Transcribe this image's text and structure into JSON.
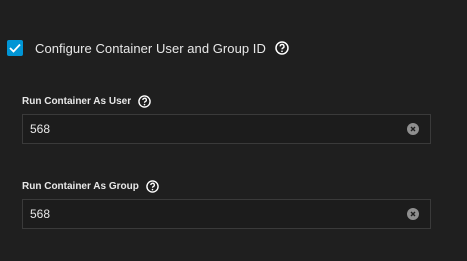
{
  "options": {
    "configure_user_group": {
      "label": "Configure Container User and Group ID",
      "checked": true,
      "icon": "checkmark-icon",
      "help_icon": "help-circle-icon"
    }
  },
  "fields": {
    "run_as_user": {
      "label": "Run Container As User",
      "value": "568",
      "clear_icon": "clear-icon",
      "help_icon": "help-circle-icon"
    },
    "run_as_group": {
      "label": "Run Container As Group",
      "value": "568",
      "clear_icon": "clear-icon",
      "help_icon": "help-circle-icon"
    }
  },
  "colors": {
    "background": "#1f1f1f",
    "checkbox_accent": "#0095d5",
    "text": "#e8e8e8",
    "input_border": "#3a3a3a"
  }
}
